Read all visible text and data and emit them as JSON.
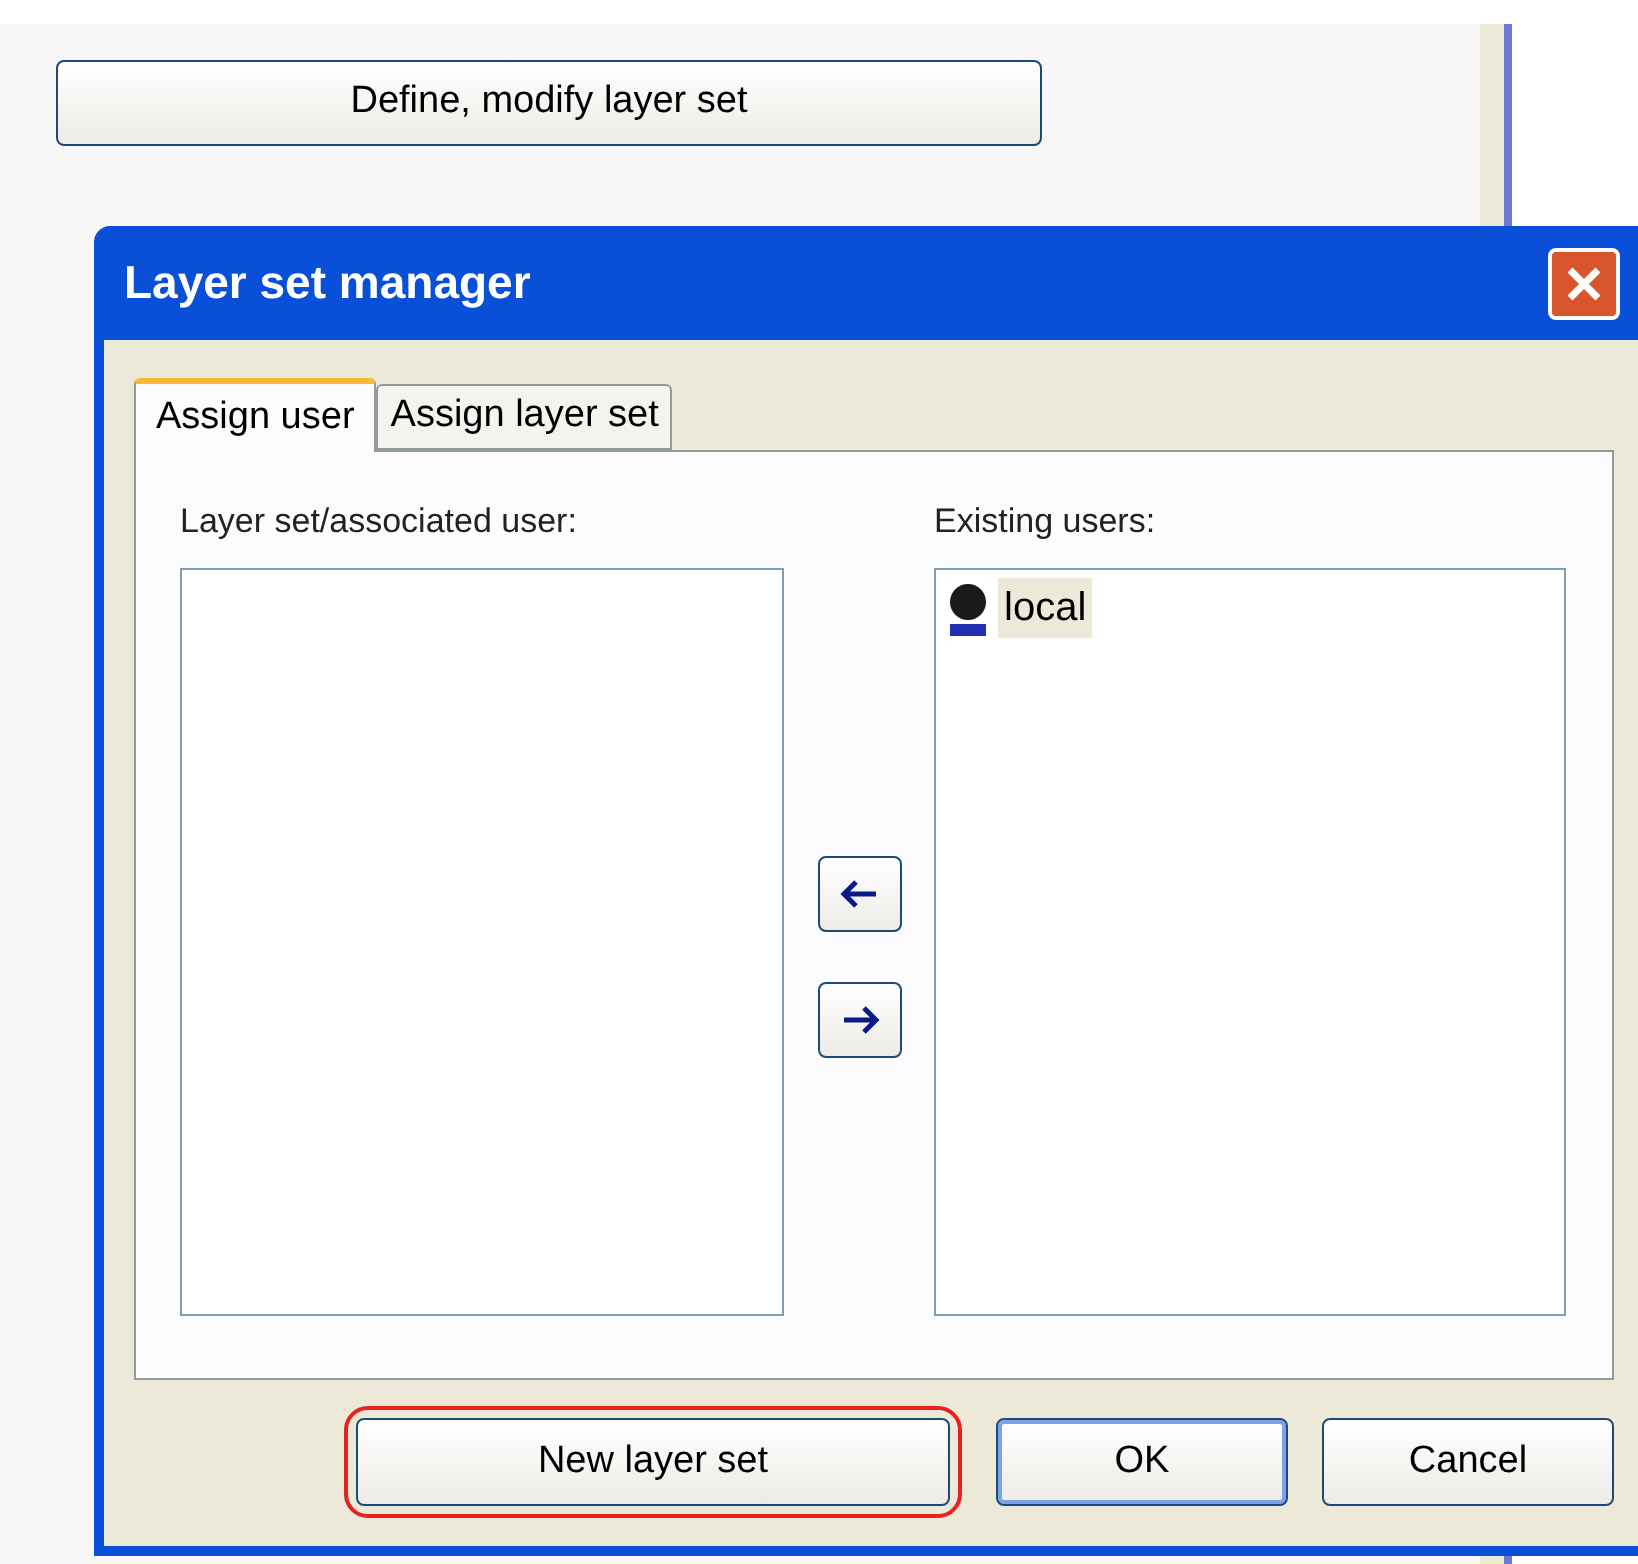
{
  "page_button": {
    "label": "Define, modify layer set"
  },
  "dialog": {
    "title": "Layer set manager",
    "tabs": [
      {
        "label": "Assign user",
        "selected": true
      },
      {
        "label": "Assign layer set",
        "selected": false
      }
    ],
    "left_list": {
      "label": "Layer set/associated user:"
    },
    "move_buttons": [
      {
        "kind": "left"
      },
      {
        "kind": "right"
      }
    ],
    "right_list": {
      "label": "Existing users:",
      "items": [
        {
          "label": "local",
          "selected": true
        }
      ]
    },
    "buttons": [
      {
        "label": "New layer set",
        "highlighted": true,
        "default": false
      },
      {
        "label": "OK",
        "highlighted": false,
        "default": true
      },
      {
        "label": "Cancel",
        "highlighted": false,
        "default": false
      }
    ]
  }
}
